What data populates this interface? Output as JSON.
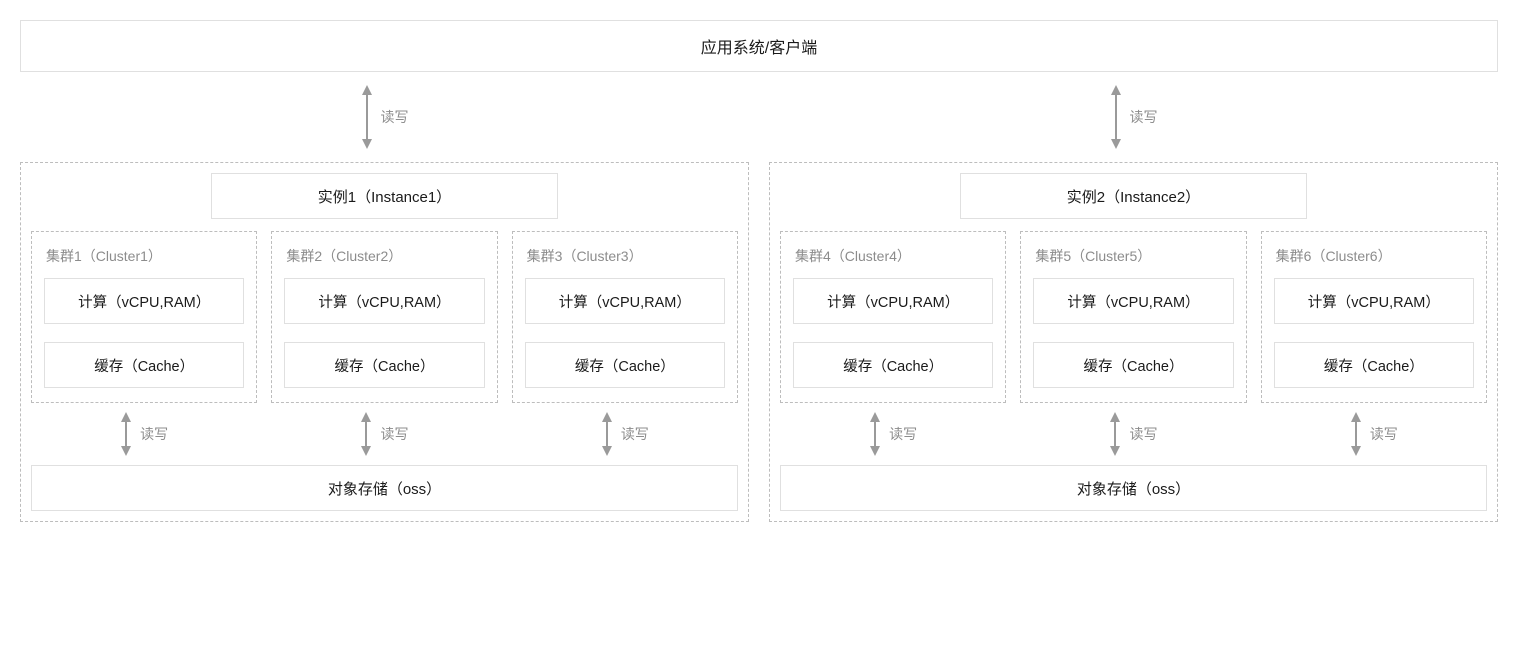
{
  "header": {
    "label": "应用系统/客户端"
  },
  "rw_label": "读写",
  "instances": [
    {
      "title": "实例1（Instance1）",
      "clusters": [
        {
          "name": "集群1（Cluster1）",
          "compute": "计算（vCPU,RAM）",
          "cache": "缓存（Cache）"
        },
        {
          "name": "集群2（Cluster2）",
          "compute": "计算（vCPU,RAM）",
          "cache": "缓存（Cache）"
        },
        {
          "name": "集群3（Cluster3）",
          "compute": "计算（vCPU,RAM）",
          "cache": "缓存（Cache）"
        }
      ],
      "storage": "对象存储（oss）"
    },
    {
      "title": "实例2（Instance2）",
      "clusters": [
        {
          "name": "集群4（Cluster4）",
          "compute": "计算（vCPU,RAM）",
          "cache": "缓存（Cache）"
        },
        {
          "name": "集群5（Cluster5）",
          "compute": "计算（vCPU,RAM）",
          "cache": "缓存（Cache）"
        },
        {
          "name": "集群6（Cluster6）",
          "compute": "计算（vCPU,RAM）",
          "cache": "缓存（Cache）"
        }
      ],
      "storage": "对象存储（oss）"
    }
  ]
}
